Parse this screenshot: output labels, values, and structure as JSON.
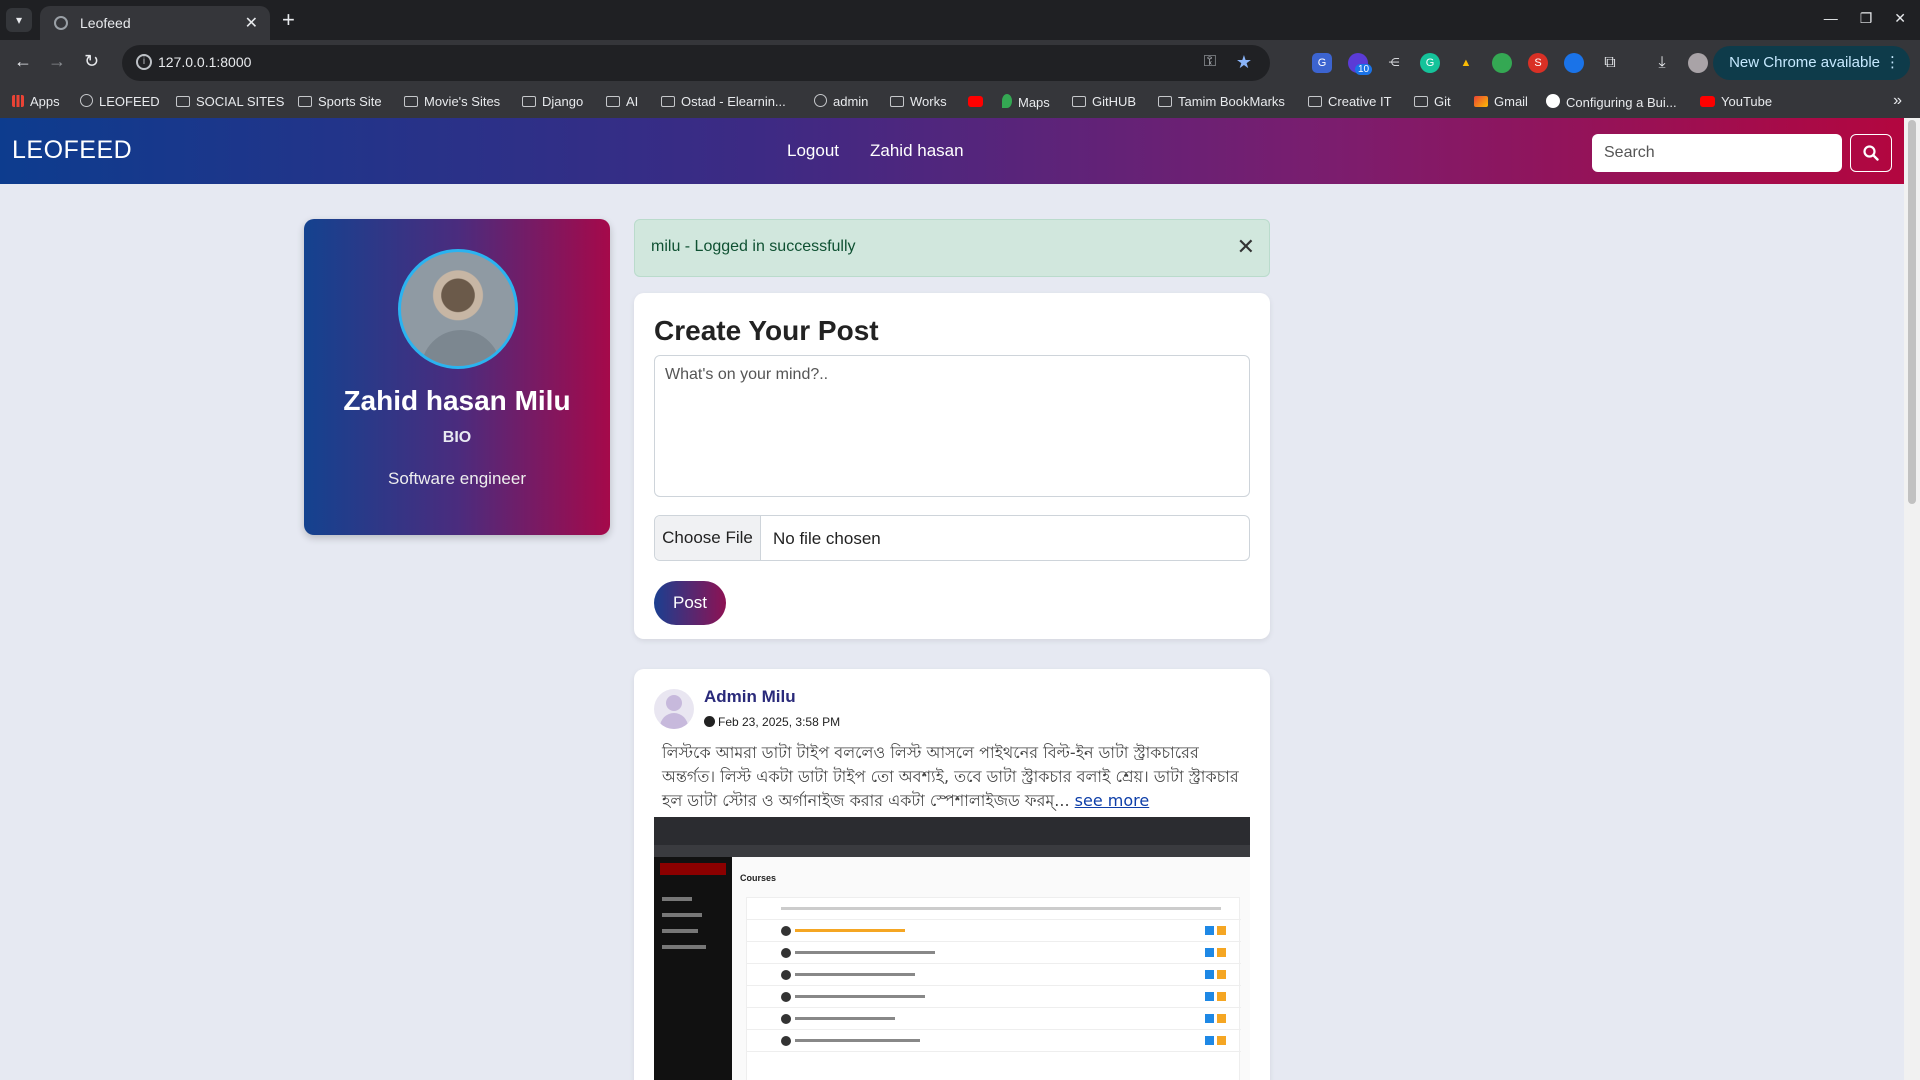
{
  "browser": {
    "tab_title": "Leofeed",
    "url": "127.0.0.1:8000",
    "new_chrome": "New Chrome available",
    "ext_badge": "10",
    "bookmarks": [
      "Apps",
      "LEOFEED",
      "SOCIAL SITES",
      "Sports Site",
      "Movie's Sites",
      "Django",
      "AI",
      "Ostad - Elearnin...",
      "admin",
      "Works",
      "",
      "Maps",
      "GitHUB",
      "Tamim BookMarks",
      "Creative IT",
      "Git",
      "Gmail",
      "Configuring a Bui...",
      "YouTube"
    ]
  },
  "navbar": {
    "brand": "LEOFEED",
    "links": [
      "Logout",
      "Zahid hasan"
    ],
    "search_placeholder": "Search"
  },
  "profile": {
    "name": "Zahid hasan Milu",
    "bio_label": "BIO",
    "bio": "Software engineer"
  },
  "alert": {
    "message": "milu - Logged in successfully"
  },
  "create_post": {
    "title": "Create Your Post",
    "placeholder": "What's on your mind?..",
    "choose_file": "Choose File",
    "no_file": "No file chosen",
    "post_button": "Post"
  },
  "feed": {
    "author": "Admin Milu",
    "timestamp": "Feb 23, 2025, 3:58 PM",
    "text": "লিস্টকে আমরা ডাটা টাইপ বললেও লিস্ট আসলে পাইথনের বিল্ট-ইন ডাটা স্ট্রাকচারের অন্তর্গত। লিস্ট একটা ডাটা টাইপ তো অবশ্যই, তবে ডাটা স্ট্রাকচার বলাই শ্রেয়। ডাটা স্ট্রাকচার হল ডাটা স্টোর ও অর্গানাইজ করার একটা স্পেশালাইজড ফরম্...",
    "see_more": "see more",
    "image_heading": "Courses"
  }
}
